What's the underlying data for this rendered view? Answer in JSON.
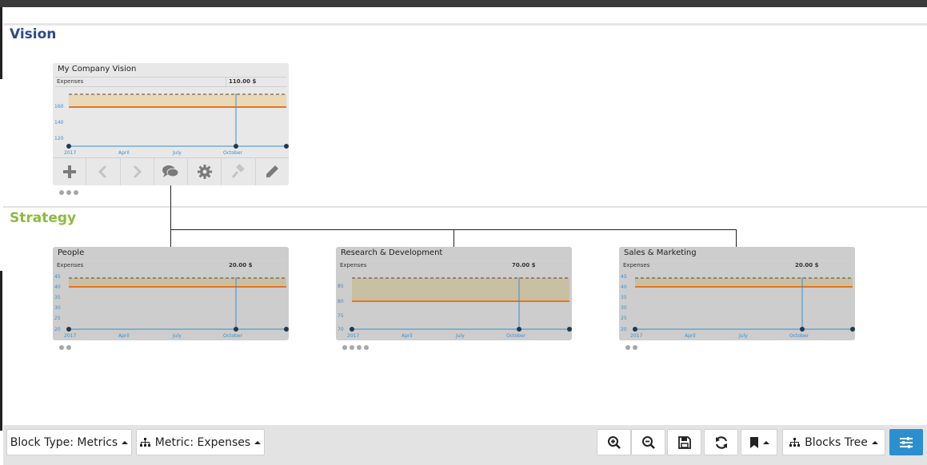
{
  "sections": {
    "vision": "Vision",
    "strategy": "Strategy"
  },
  "vision_card": {
    "title": "My Company Vision",
    "metric_label": "Expenses",
    "metric_value": "110.00 $",
    "y_ticks": [
      "160",
      "140",
      "120"
    ],
    "x_ticks": [
      "2017",
      "April",
      "July",
      "October"
    ],
    "dots": 3
  },
  "strategy_cards": [
    {
      "title": "People",
      "metric_label": "Expenses",
      "metric_value": "20.00 $",
      "y_ticks": [
        "45",
        "40",
        "35",
        "30",
        "25",
        "20"
      ],
      "x_ticks": [
        "2017",
        "April",
        "July",
        "October"
      ],
      "dots": 2
    },
    {
      "title": "Research & Development",
      "metric_label": "Expenses",
      "metric_value": "70.00 $",
      "y_ticks": [
        "85",
        "80",
        "75",
        "70"
      ],
      "x_ticks": [
        "2017",
        "April",
        "July",
        "October"
      ],
      "dots": 4
    },
    {
      "title": "Sales & Marketing",
      "metric_label": "Expenses",
      "metric_value": "20.00 $",
      "y_ticks": [
        "45",
        "40",
        "35",
        "30",
        "25",
        "20"
      ],
      "x_ticks": [
        "2017",
        "April",
        "July",
        "October"
      ],
      "dots": 2
    }
  ],
  "card_tools": [
    "plus-icon",
    "chevron-left-icon",
    "chevron-right-icon",
    "comments-icon",
    "gear-icon",
    "gavel-icon",
    "pencil-icon"
  ],
  "bottom_bar": {
    "block_type": "Block Type: Metrics",
    "metric": "Metric: Expenses",
    "blocks_tree": "Blocks Tree"
  },
  "colors": {
    "vision_title": "#2e4a8a",
    "strategy_title": "#8dbb3d",
    "axis_blue": "#3a8fc9",
    "target_orange": "#e8731f",
    "band_fill": "#e9d9b6",
    "band_fill_gray": "#c9c0a4",
    "accent_blue": "#2b8fcf"
  }
}
